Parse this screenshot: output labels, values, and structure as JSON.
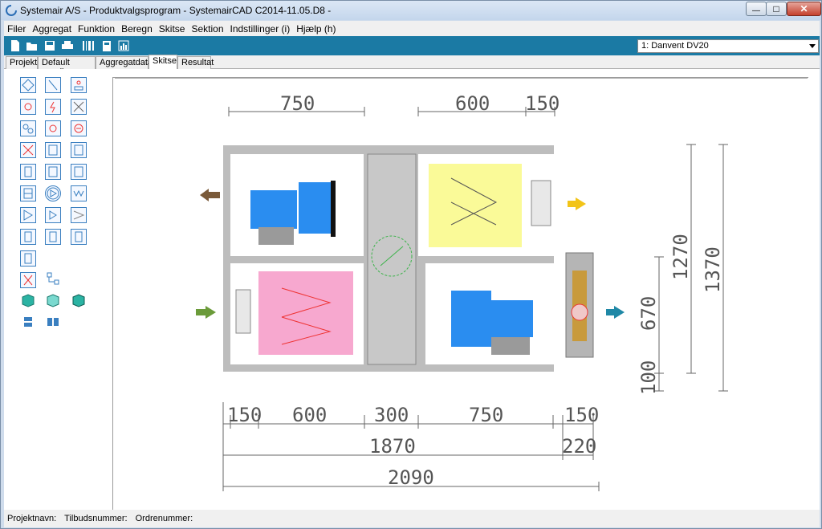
{
  "window": {
    "title": "Systemair A/S - Produktvalgsprogram - SystemairCAD C2014-11.05.D8 -",
    "min_glyph": "—",
    "max_glyph": "□",
    "close_glyph": "✕"
  },
  "menu": [
    "Filer",
    "Aggregat",
    "Funktion",
    "Beregn",
    "Skitse",
    "Sektion",
    "Indstillinger (i)",
    "Hjælp (h)"
  ],
  "toolbar": {
    "icons": [
      "new-file-icon",
      "open-folder-icon",
      "save-icon",
      "print-icon",
      "barcode-icon",
      "calculator-icon",
      "chart-icon"
    ],
    "unit_select": "1:  Danvent DV20"
  },
  "tabs": [
    {
      "label": "Projekt",
      "active": false
    },
    {
      "label": "Default værdier",
      "active": false
    },
    {
      "label": "Aggregatdata",
      "active": false
    },
    {
      "label": "Skitse",
      "active": true
    },
    {
      "label": "Resultat",
      "active": false
    }
  ],
  "drawing": {
    "top_dims": [
      "750",
      "600",
      "150"
    ],
    "bottom_dims": [
      "150",
      "600",
      "300",
      "750",
      "150"
    ],
    "total_left": "1870",
    "total_right": "220",
    "total_all": "2090",
    "right_dims_inner": [
      "1270",
      "670",
      "100"
    ],
    "right_dims_outer": "1370"
  },
  "status": {
    "projekt": "Projektnavn:",
    "tilbud": "Tilbudsnummer:",
    "ordre": "Ordrenummer:"
  }
}
